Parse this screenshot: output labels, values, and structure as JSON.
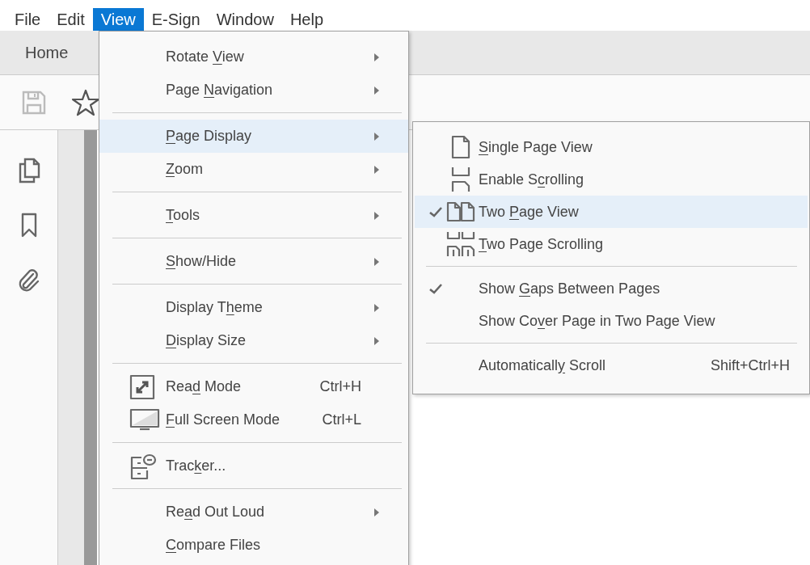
{
  "menubar": [
    {
      "label": "File",
      "selected": false
    },
    {
      "label": "Edit",
      "selected": false
    },
    {
      "label": "View",
      "selected": true
    },
    {
      "label": "E-Sign",
      "selected": false
    },
    {
      "label": "Window",
      "selected": false
    },
    {
      "label": "Help",
      "selected": false
    }
  ],
  "tabs": [
    {
      "label": "Home",
      "selected": true
    }
  ],
  "view_menu": {
    "items": [
      {
        "kind": "item",
        "label": {
          "before": "Rotate ",
          "key": "V",
          "after": "iew"
        },
        "submenu": true,
        "selected": false
      },
      {
        "kind": "item",
        "label": {
          "before": "Page ",
          "key": "N",
          "after": "avigation"
        },
        "submenu": true,
        "selected": false
      },
      {
        "kind": "separator"
      },
      {
        "kind": "item",
        "label": {
          "key": "P",
          "after": "age Display"
        },
        "submenu": true,
        "selected": true
      },
      {
        "kind": "item",
        "label": {
          "key": "Z",
          "after": "oom"
        },
        "submenu": true,
        "selected": false
      },
      {
        "kind": "separator"
      },
      {
        "kind": "item",
        "label": {
          "key": "T",
          "after": "ools"
        },
        "submenu": true,
        "selected": false
      },
      {
        "kind": "separator"
      },
      {
        "kind": "item",
        "label": {
          "key": "S",
          "after": "how/Hide"
        },
        "submenu": true,
        "selected": false
      },
      {
        "kind": "separator"
      },
      {
        "kind": "item",
        "label": {
          "before": "Display T",
          "key": "h",
          "after": "eme"
        },
        "submenu": true,
        "selected": false
      },
      {
        "kind": "item",
        "label": {
          "key": "D",
          "after": "isplay Size"
        },
        "submenu": true,
        "selected": false
      },
      {
        "kind": "separator"
      },
      {
        "kind": "item",
        "label": {
          "before": "Rea",
          "key": "d",
          "after": " Mode"
        },
        "shortcut": "Ctrl+H",
        "submenu": false,
        "selected": false
      },
      {
        "kind": "item",
        "label": {
          "key": "F",
          "after": "ull Screen Mode"
        },
        "shortcut": "Ctrl+L",
        "submenu": false,
        "selected": false
      },
      {
        "kind": "separator"
      },
      {
        "kind": "item",
        "label": {
          "before": "Trac",
          "key": "k",
          "after": "er..."
        },
        "submenu": false,
        "selected": false
      },
      {
        "kind": "separator"
      },
      {
        "kind": "item",
        "label": {
          "before": "Re",
          "key": "a",
          "after": "d Out Loud"
        },
        "submenu": true,
        "selected": false
      },
      {
        "kind": "item",
        "label": {
          "key": "C",
          "after": "ompare Files"
        },
        "submenu": false,
        "selected": false
      }
    ]
  },
  "page_display_menu": {
    "items": [
      {
        "kind": "item",
        "label": {
          "key": "S",
          "after": "ingle Page View"
        },
        "checked": false,
        "selected": false
      },
      {
        "kind": "item",
        "label": {
          "before": "Enable S",
          "key": "c",
          "after": "rolling"
        },
        "checked": false,
        "selected": false
      },
      {
        "kind": "item",
        "label": {
          "before": "Two ",
          "key": "P",
          "after": "age View"
        },
        "checked": true,
        "selected": true
      },
      {
        "kind": "item",
        "label": {
          "key": "T",
          "after": "wo Page Scrolling"
        },
        "checked": false,
        "selected": false
      },
      {
        "kind": "separator"
      },
      {
        "kind": "item",
        "label": {
          "before": "Show ",
          "key": "G",
          "after": "aps Between Pages"
        },
        "checked": true,
        "selected": false
      },
      {
        "kind": "item",
        "label": {
          "before": "Show Co",
          "key": "v",
          "after": "er Page in Two Page View"
        },
        "checked": false,
        "selected": false
      },
      {
        "kind": "separator"
      },
      {
        "kind": "item",
        "label": {
          "before": "Automaticall",
          "key": "y",
          "after": " Scroll"
        },
        "shortcut": "Shift+Ctrl+H",
        "checked": false,
        "selected": false
      }
    ]
  }
}
